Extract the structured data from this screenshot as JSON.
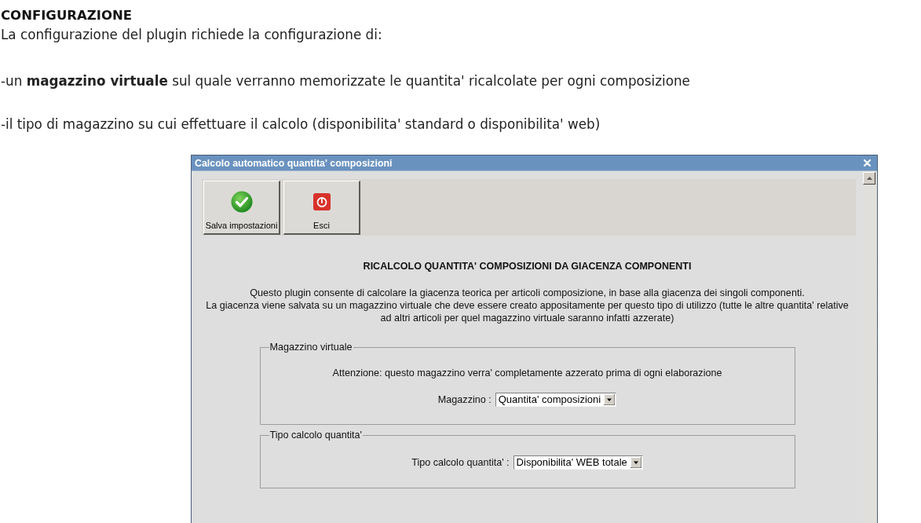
{
  "article": {
    "heading": "CONFIGURAZIONE",
    "paragraphs": [
      "La configurazione del plugin richiede la configurazione di:",
      "-un **magazzino virtuale** sul quale verranno memorizzate le quantita' ricalcolate per ogni composizione",
      "-il tipo di magazzino su cui effettuare il calcolo (disponibilita' standard o disponibilita' web)"
    ]
  },
  "dialog": {
    "title": "Calcolo automatico quantita' composizioni",
    "toolbar": [
      {
        "label": "Salva impostazioni",
        "kind": "save"
      },
      {
        "label": "Esci",
        "kind": "exit"
      }
    ],
    "heading": "RICALCOLO QUANTITA' COMPOSIZIONI DA GIACENZA COMPONENTI",
    "description": [
      "Questo plugin consente di calcolare la giacenza teorica per articoli composizione, in base alla giacenza dei singoli componenti.",
      "La giacenza viene salvata su un magazzino virtuale che deve essere creato appositamente per questo tipo di utilizzo (tutte le altre quantita' relative ad altri articoli per quel magazzino virtuale saranno infatti azzerate)"
    ],
    "groups": [
      {
        "legend": "Magazzino virtuale",
        "note": "Attenzione: questo magazzino verra' completamente azzerato prima di ogni elaborazione",
        "field": {
          "label": "Magazzino :",
          "value": "Quantita' composizioni"
        }
      },
      {
        "legend": "Tipo calcolo quantita'",
        "field": {
          "label": "Tipo calcolo quantita' :",
          "value": "Disponibilita' WEB totale"
        }
      }
    ]
  }
}
